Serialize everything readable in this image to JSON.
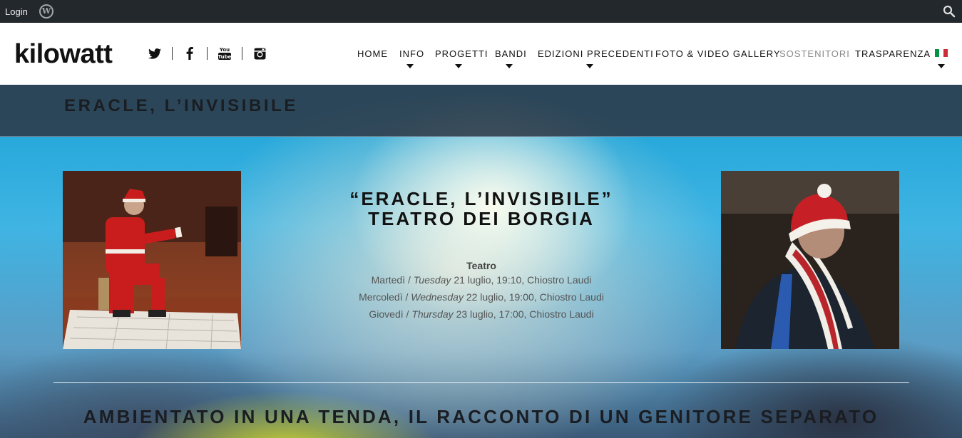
{
  "adminbar": {
    "login_label": "Login",
    "wp_icon": "wordpress-icon",
    "search_icon": "search-icon"
  },
  "header": {
    "logo": "kilowatt",
    "social": [
      "twitter-icon",
      "facebook-icon",
      "youtube-icon",
      "instagram-icon"
    ],
    "nav": [
      {
        "label": "HOME",
        "has_dropdown": false
      },
      {
        "label": "INFO",
        "has_dropdown": true
      },
      {
        "label": "PROGETTI",
        "has_dropdown": true
      },
      {
        "label": "BANDI",
        "has_dropdown": true
      },
      {
        "label": "EDIZIONI PRECEDENTI",
        "has_dropdown": true
      },
      {
        "label": "FOTO & VIDEO GALLERY",
        "has_dropdown": false
      },
      {
        "label": "SOSTENITORI",
        "has_dropdown": false,
        "active": true
      },
      {
        "label": "TRASPARENZA",
        "has_dropdown": false
      }
    ],
    "language_flag": "italian-flag-icon"
  },
  "page": {
    "title": "ERACLE, L’INVISIBILE",
    "show_title_line1": "“ERACLE, L’INVISIBILE”",
    "show_title_line2": "TEATRO DEI BORGIA",
    "category": "Teatro",
    "schedule": [
      {
        "it": "Martedì /",
        "en": "Tuesday",
        "rest": "21 luglio, 19:10, Chiostro Laudi"
      },
      {
        "it": "Mercoledì /",
        "en": "Wednesday",
        "rest": "22 luglio, 19:00, Chiostro Laudi"
      },
      {
        "it": "Giovedì /",
        "en": "Thursday",
        "rest": "23 luglio, 17:00, Chiostro Laudi"
      }
    ],
    "subtitle": "AMBIENTATO IN UNA TENDA, IL RACCONTO DI UN GENITORE SEPARATO"
  },
  "colors": {
    "accent_muted": "#888888",
    "admin_bg": "#23282d"
  }
}
